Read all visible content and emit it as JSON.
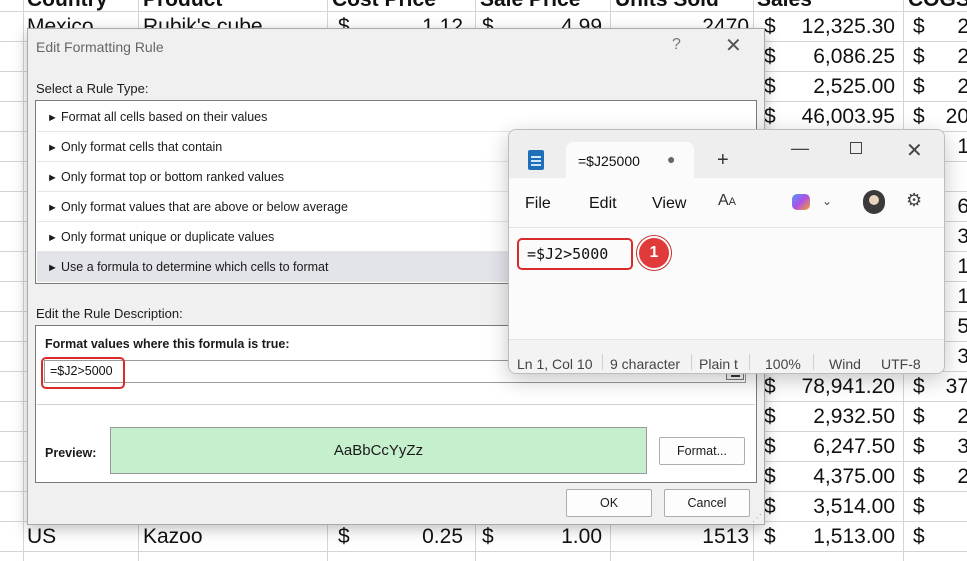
{
  "spreadsheet": {
    "header": [
      "Country",
      "Product",
      "Cost Price",
      "Sale Price",
      "Units Sold",
      "Sales",
      "COGS"
    ],
    "rows": [
      {
        "country": "Mexico",
        "product": "Rubik's cube",
        "cost_sym": "$",
        "cost": "1.12",
        "sale_sym": "$",
        "sale": "4.99",
        "units": "2470",
        "sales_sym": "$",
        "sales": "12,325.30",
        "cogs_sym": "$",
        "cogs": "2"
      },
      {
        "country": "",
        "product": "",
        "cost_sym": "",
        "cost": "",
        "sale_sym": "",
        "sale": "",
        "units": "",
        "sales_sym": "$",
        "sales": "6,086.25",
        "cogs_sym": "$",
        "cogs": "2"
      },
      {
        "country": "",
        "product": "",
        "cost_sym": "",
        "cost": "",
        "sale_sym": "",
        "sale": "",
        "units": "",
        "sales_sym": "$",
        "sales": "2,525.00",
        "cogs_sym": "$",
        "cogs": "2"
      },
      {
        "country": "",
        "product": "",
        "cost_sym": "",
        "cost": "",
        "sale_sym": "",
        "sale": "",
        "units": "",
        "sales_sym": "$",
        "sales": "46,003.95",
        "cogs_sym": "$",
        "cogs": "20"
      },
      {
        "country": "",
        "product": "",
        "cost_sym": "",
        "cost": "",
        "sale_sym": "",
        "sale": "",
        "units": "",
        "sales_sym": "",
        "sales": "",
        "cogs_sym": "",
        "cogs": "1"
      },
      {
        "country": "",
        "product": "",
        "cost_sym": "",
        "cost": "",
        "sale_sym": "",
        "sale": "",
        "units": "",
        "sales_sym": "",
        "sales": "",
        "cogs_sym": "",
        "cogs": ""
      },
      {
        "country": "",
        "product": "",
        "cost_sym": "",
        "cost": "",
        "sale_sym": "",
        "sale": "",
        "units": "",
        "sales_sym": "",
        "sales": "",
        "cogs_sym": "",
        "cogs": "6"
      },
      {
        "country": "",
        "product": "",
        "cost_sym": "",
        "cost": "",
        "sale_sym": "",
        "sale": "",
        "units": "",
        "sales_sym": "",
        "sales": "",
        "cogs_sym": "",
        "cogs": "3"
      },
      {
        "country": "",
        "product": "",
        "cost_sym": "",
        "cost": "",
        "sale_sym": "",
        "sale": "",
        "units": "",
        "sales_sym": "",
        "sales": "",
        "cogs_sym": "",
        "cogs": "1"
      },
      {
        "country": "",
        "product": "",
        "cost_sym": "",
        "cost": "",
        "sale_sym": "",
        "sale": "",
        "units": "",
        "sales_sym": "",
        "sales": "",
        "cogs_sym": "",
        "cogs": "1"
      },
      {
        "country": "",
        "product": "",
        "cost_sym": "",
        "cost": "",
        "sale_sym": "",
        "sale": "",
        "units": "",
        "sales_sym": "",
        "sales": "",
        "cogs_sym": "",
        "cogs": "5"
      },
      {
        "country": "",
        "product": "",
        "cost_sym": "",
        "cost": "",
        "sale_sym": "",
        "sale": "",
        "units": "",
        "sales_sym": "",
        "sales": "",
        "cogs_sym": "",
        "cogs": "3"
      },
      {
        "country": "",
        "product": "",
        "cost_sym": "",
        "cost": "",
        "sale_sym": "",
        "sale": "",
        "units": "",
        "sales_sym": "$",
        "sales": "78,941.20",
        "cogs_sym": "$",
        "cogs": "37"
      },
      {
        "country": "",
        "product": "",
        "cost_sym": "",
        "cost": "",
        "sale_sym": "",
        "sale": "",
        "units": "",
        "sales_sym": "$",
        "sales": "2,932.50",
        "cogs_sym": "$",
        "cogs": "2"
      },
      {
        "country": "",
        "product": "",
        "cost_sym": "",
        "cost": "",
        "sale_sym": "",
        "sale": "",
        "units": "",
        "sales_sym": "$",
        "sales": "6,247.50",
        "cogs_sym": "$",
        "cogs": "3"
      },
      {
        "country": "",
        "product": "",
        "cost_sym": "",
        "cost": "",
        "sale_sym": "",
        "sale": "",
        "units": "",
        "sales_sym": "$",
        "sales": "4,375.00",
        "cogs_sym": "$",
        "cogs": "2"
      },
      {
        "country": "",
        "product": "",
        "cost_sym": "",
        "cost": "",
        "sale_sym": "",
        "sale": "",
        "units": "",
        "sales_sym": "$",
        "sales": "3,514.00",
        "cogs_sym": "$",
        "cogs": ""
      },
      {
        "country": "US",
        "product": "Kazoo",
        "cost_sym": "$",
        "cost": "0.25",
        "sale_sym": "$",
        "sale": "1.00",
        "units": "1513",
        "sales_sym": "$",
        "sales": "1,513.00",
        "cogs_sym": "$",
        "cogs": ""
      }
    ]
  },
  "dialog": {
    "title": "Edit Formatting Rule",
    "help": "?",
    "close": "✕",
    "select_rule_type_label": "Select a Rule Type:",
    "rule_types": [
      "Format all cells based on their values",
      "Only format cells that contain",
      "Only format top or bottom ranked values",
      "Only format values that are above or below average",
      "Only format unique or duplicate values",
      "Use a formula to determine which cells to format"
    ],
    "selected_rule_index": 5,
    "edit_description_label": "Edit the Rule Description:",
    "formula_label": "Format values where this formula is true:",
    "formula_value": "=$J2>5000",
    "preview_label": "Preview:",
    "preview_sample": "AaBbCcYyZz",
    "preview_fill_color": "#c6efce",
    "format_button": "Format...",
    "ok_button": "OK",
    "cancel_button": "Cancel"
  },
  "notepad": {
    "tab_title": "=$J25000",
    "tab_unsaved_dot": "●",
    "new_tab": "+",
    "minimize": "—",
    "close": "✕",
    "menu": [
      "File",
      "Edit",
      "View"
    ],
    "icons": [
      "notepad-icon",
      "font-icon",
      "copilot-icon",
      "avatar",
      "gear-icon"
    ],
    "content": "=$J2>5000",
    "callout_number": "1",
    "status": {
      "position": "Ln 1, Col 10",
      "characters": "9 character",
      "format": "Plain t",
      "zoom": "100%",
      "line_endings": "Wind",
      "encoding": "UTF-8"
    },
    "highlight_color": "#d92b2b"
  }
}
